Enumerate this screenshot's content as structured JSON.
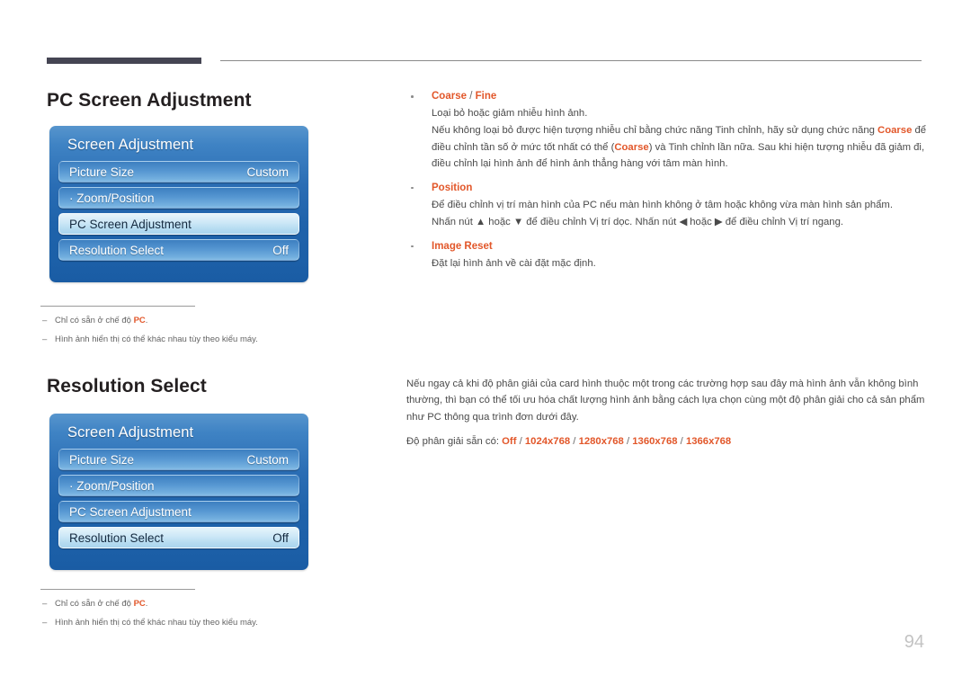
{
  "page": {
    "number": "94"
  },
  "sections": [
    {
      "id": "pc-screen-adjustment",
      "title": "PC Screen Adjustment"
    },
    {
      "id": "resolution-select",
      "title": "Resolution Select"
    }
  ],
  "osd_panels": [
    {
      "id": "panel-one",
      "title": "Screen Adjustment",
      "rows": [
        {
          "label": "Picture Size",
          "value": "Custom",
          "selected": false
        },
        {
          "label": "· Zoom/Position",
          "value": "",
          "selected": false
        },
        {
          "label": "PC Screen Adjustment",
          "value": "",
          "selected": true
        },
        {
          "label": "Resolution Select",
          "value": "Off",
          "selected": false
        }
      ]
    },
    {
      "id": "panel-two",
      "title": "Screen Adjustment",
      "rows": [
        {
          "label": "Picture Size",
          "value": "Custom",
          "selected": false
        },
        {
          "label": "· Zoom/Position",
          "value": "",
          "selected": false
        },
        {
          "label": "PC Screen Adjustment",
          "value": "",
          "selected": false
        },
        {
          "label": "Resolution Select",
          "value": "Off",
          "selected": true
        }
      ]
    }
  ],
  "footnotes": {
    "first": {
      "note1_prefix": "Chỉ có sẵn ở chế độ ",
      "note1_keyword": "PC",
      "note1_suffix": ".",
      "note2": "Hình ảnh hiển thị có thể khác nhau tùy theo kiểu máy."
    },
    "second": {
      "note1_prefix": "Chỉ có sẵn ở chế độ ",
      "note1_keyword": "PC",
      "note1_suffix": ".",
      "note2": "Hình ảnh hiển thị có thể khác nhau tùy theo kiểu máy."
    }
  },
  "right_column_top": {
    "bullets": [
      {
        "head_part1": "Coarse",
        "head_sep": " / ",
        "head_part2": "Fine",
        "body_line1": "Loại bỏ hoặc giảm nhiễu hình ảnh.",
        "body_line2": "Nếu không loại bỏ được hiện tượng nhiễu chỉ bằng chức năng Tinh chỉnh, hãy sử dụng chức năng Coarse để điều chỉnh tần số ở mức tốt nhất có thể (Coarse) và Tinh chỉnh lần nữa. Sau khi hiện tượng nhiễu đã giảm đi, điều chỉnh lại hình ảnh để hình ảnh thẳng hàng với tâm màn hình."
      },
      {
        "head_part1": "Position",
        "head_sep": "",
        "head_part2": "",
        "body_line1": "Để điều chỉnh vị trí màn hình của PC nếu màn hình không ở tâm hoặc không vừa màn hình sản phẩm.",
        "body_line2": "Nhấn nút ▲ hoặc ▼ để điều chỉnh Vị trí dọc. Nhấn nút ◀ hoặc ▶ để điều chỉnh Vị trí ngang."
      },
      {
        "head_part1": "Image Reset",
        "head_sep": "",
        "head_part2": "",
        "body_line1": "Đặt lại hình ảnh về cài đặt mặc định.",
        "body_line2": ""
      }
    ]
  },
  "right_column_bottom": {
    "paragraph": "Nếu ngay cả khi độ phân giải của card hình thuộc một trong các trường hợp sau đây mà hình ảnh vẫn không bình thường, thì bạn có thể tối ưu hóa chất lượng hình ảnh bằng cách lựa chọn cùng một độ phân giải cho cả sản phẩm như PC thông qua trình đơn dưới đây.",
    "resolution_label": "Độ phân giải sẵn có: ",
    "resolution_options": [
      "Off",
      "1024x768",
      "1280x768",
      "1360x768",
      "1366x768"
    ]
  },
  "colors": {
    "accent_orange": "#e2572a",
    "panel_blue_light": "#5795cd",
    "panel_blue_dark": "#1a5ca4",
    "heading_dark": "#231f20",
    "rule_dark": "#454553",
    "page_number_gray": "#c3c3c3"
  }
}
